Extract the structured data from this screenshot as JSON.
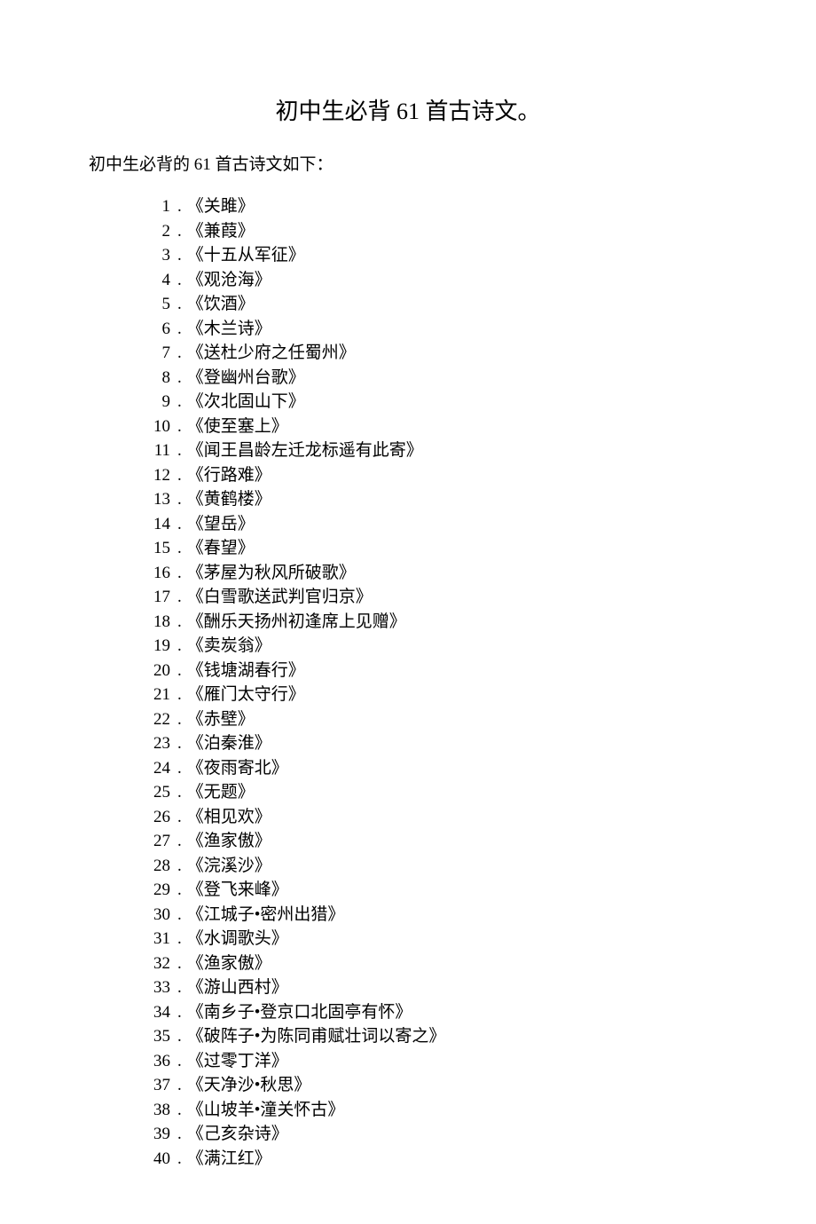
{
  "title": "初中生必背 61 首古诗文。",
  "intro": "初中生必背的 61 首古诗文如下：",
  "items": [
    "《关雎》",
    "《兼葭》",
    "《十五从军征》",
    "《观沧海》",
    "《饮酒》",
    "《木兰诗》",
    "《送杜少府之任蜀州》",
    "《登幽州台歌》",
    "《次北固山下》",
    "《使至塞上》",
    "《闻王昌龄左迁龙标遥有此寄》",
    "《行路难》",
    "《黄鹤楼》",
    "《望岳》",
    "《春望》",
    "《茅屋为秋风所破歌》",
    "《白雪歌送武判官归京》",
    "《酬乐天扬州初逢席上见赠》",
    "《卖炭翁》",
    "《钱塘湖春行》",
    "《雁门太守行》",
    "《赤壁》",
    "《泊秦淮》",
    "《夜雨寄北》",
    "《无题》",
    "《相见欢》",
    "《渔家傲》",
    "《浣溪沙》",
    "《登飞来峰》",
    "《江城子•密州出猎》",
    "《水调歌头》",
    "《渔家傲》",
    "《游山西村》",
    "《南乡子•登京口北固亭有怀》",
    "《破阵子•为陈同甫赋壮词以寄之》",
    "《过零丁洋》",
    "《天净沙•秋思》",
    "《山坡羊•潼关怀古》",
    "《己亥杂诗》",
    "《满江红》"
  ]
}
